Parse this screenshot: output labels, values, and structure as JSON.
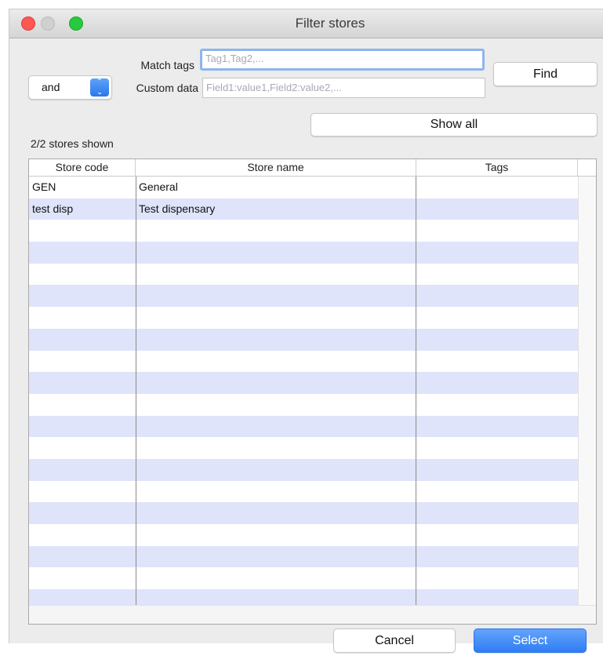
{
  "window": {
    "title": "Filter stores"
  },
  "filter": {
    "match_tags_label": "Match tags",
    "match_tags_placeholder": "Tag1,Tag2,...",
    "custom_data_label": "Custom data",
    "custom_data_placeholder": "Field1:value1,Field2:value2,...",
    "operator_value": "and",
    "find_label": "Find",
    "show_all_label": "Show all"
  },
  "status": {
    "shown_text": "2/2 stores shown"
  },
  "table": {
    "columns": [
      "Store code",
      "Store name",
      "Tags"
    ],
    "rows": [
      {
        "code": "GEN",
        "name": "General",
        "tags": ""
      },
      {
        "code": "test disp",
        "name": "Test dispensary",
        "tags": ""
      }
    ]
  },
  "footer": {
    "cancel_label": "Cancel",
    "select_label": "Select"
  },
  "colors": {
    "accent": "#2f7df5",
    "row_alt": "#dfe4fb"
  }
}
